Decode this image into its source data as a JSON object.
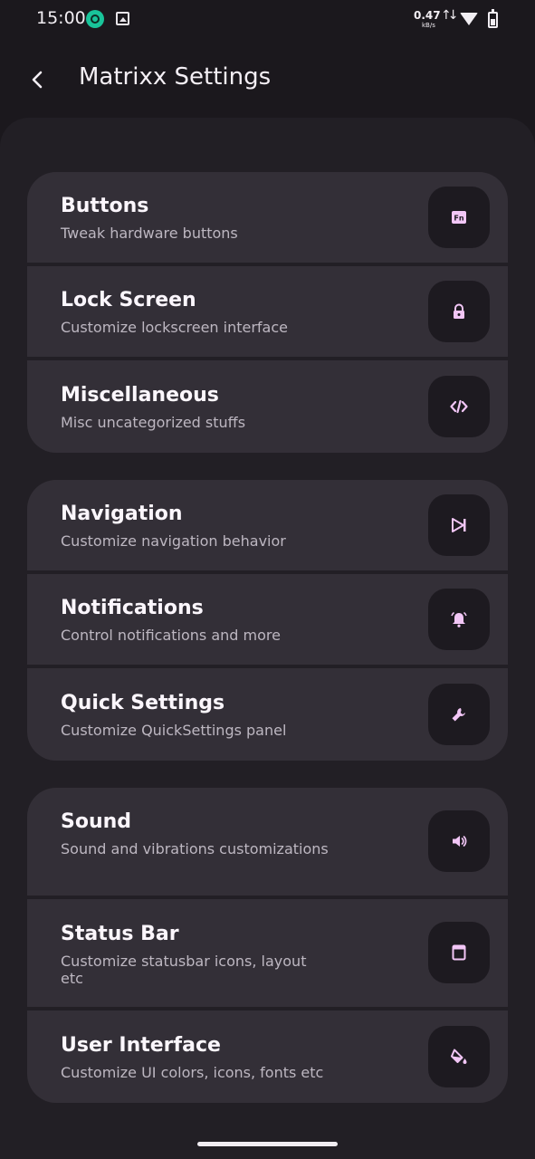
{
  "status_bar": {
    "time": "15:00",
    "speed": "0.47",
    "speed_unit": "kB/s",
    "traffic_arrows": "↑↓",
    "icons": [
      "app-notification-icon",
      "gallery-icon",
      "wifi-icon",
      "battery-icon"
    ]
  },
  "app_bar": {
    "title": "Matrixx Settings",
    "back_icon": "back-arrow-icon"
  },
  "groups": [
    {
      "items": [
        {
          "title": "Buttons",
          "subtitle": "Tweak hardware buttons",
          "icon": "fn-key-icon"
        },
        {
          "title": "Lock Screen",
          "subtitle": "Customize lockscreen interface",
          "icon": "lock-icon"
        },
        {
          "title": "Miscellaneous",
          "subtitle": "Misc uncategorized stuffs",
          "icon": "code-icon"
        }
      ]
    },
    {
      "items": [
        {
          "title": "Navigation",
          "subtitle": "Customize navigation behavior",
          "icon": "navigation-icon"
        },
        {
          "title": "Notifications",
          "subtitle": "Control notifications and more",
          "icon": "bell-icon"
        },
        {
          "title": "Quick Settings",
          "subtitle": "Customize QuickSettings panel",
          "icon": "wrench-icon"
        }
      ]
    },
    {
      "items": [
        {
          "title": "Sound",
          "subtitle": "Sound and vibrations customizations",
          "icon": "speaker-icon"
        },
        {
          "title": "Status Bar",
          "subtitle": "Customize statusbar icons, layout etc",
          "icon": "status-bar-icon"
        },
        {
          "title": "User Interface",
          "subtitle": "Customize UI colors, icons, fonts etc",
          "icon": "paint-bucket-icon"
        }
      ]
    }
  ],
  "colors": {
    "background": "#1b181d",
    "card": "#332f37",
    "icon_tile": "#1d1a20",
    "accent": "#f2c6f6"
  }
}
